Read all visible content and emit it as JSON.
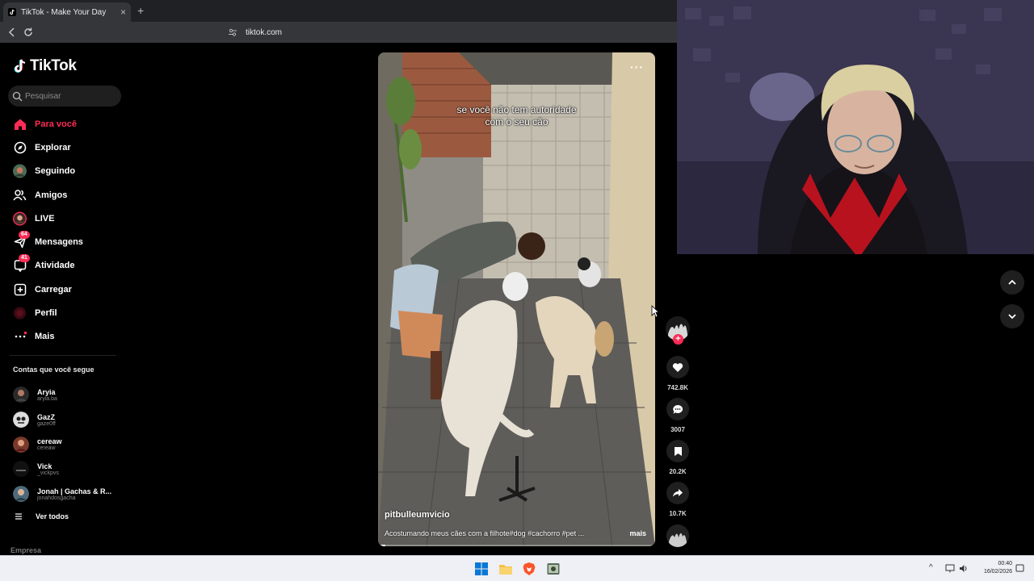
{
  "browser": {
    "tab_title": "TikTok - Make Your Day",
    "url": "tiktok.com"
  },
  "sidebar": {
    "brand": "TikTok",
    "search_placeholder": "Pesquisar",
    "menu": [
      {
        "label": "Para você",
        "icon": "home-icon",
        "active": true
      },
      {
        "label": "Explorar",
        "icon": "compass-icon"
      },
      {
        "label": "Seguindo",
        "icon": "following-avatar-icon"
      },
      {
        "label": "Amigos",
        "icon": "friends-icon"
      },
      {
        "label": "LIVE",
        "icon": "live-avatar-icon"
      },
      {
        "label": "Mensagens",
        "icon": "message-icon",
        "badge": "64"
      },
      {
        "label": "Atividade",
        "icon": "activity-icon",
        "badge": "41"
      },
      {
        "label": "Carregar",
        "icon": "upload-icon"
      },
      {
        "label": "Perfil",
        "icon": "profile-avatar-icon"
      },
      {
        "label": "Mais",
        "icon": "more-icon"
      }
    ],
    "following_title": "Contas que você segue",
    "following": [
      {
        "name": "Aryia",
        "handle": "aryia.ba"
      },
      {
        "name": "GazZ",
        "handle": "gaze0ff"
      },
      {
        "name": "cereaw",
        "handle": "cereaw"
      },
      {
        "name": "Vick",
        "handle": "_vickpvs"
      },
      {
        "name": "Jonah | Gachas & R...",
        "handle": "jonahdosgacha"
      }
    ],
    "see_all": "Ver todos",
    "footer": "Empresa"
  },
  "video": {
    "caption_line1": "se você não tem autoridade",
    "caption_line2": "com o seu cão",
    "author": "pitbulleumvicio",
    "description": "Acostumando meus cães com a filhote#dog #cachorro #pet ...",
    "more_label": "mais",
    "progress": 0.025
  },
  "actions": {
    "likes": "742.8K",
    "comments": "3007",
    "saves": "20.2K",
    "shares": "10.7K"
  },
  "taskbar": {
    "time": "00:40",
    "date": "16/02/2026"
  },
  "colors": {
    "accent": "#fe2c55",
    "background": "#000000",
    "chrome": "#35363a"
  }
}
